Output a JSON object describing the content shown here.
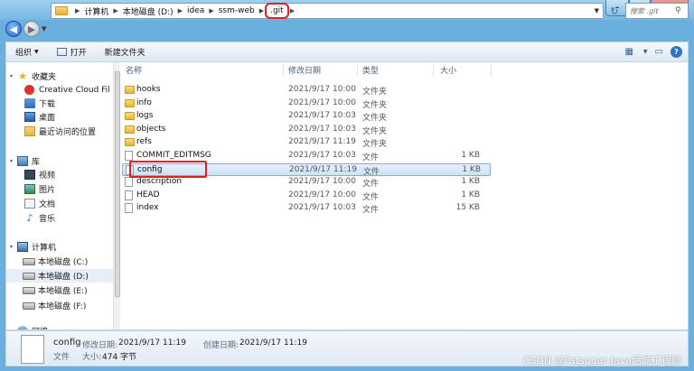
{
  "address": {
    "crumbs": [
      "计算机",
      "本地磁盘 (D:)",
      "idea",
      "ssm-web",
      ".git"
    ]
  },
  "search": {
    "placeholder": "搜索 .git"
  },
  "toolbar": {
    "organize": "组织",
    "open": "打开",
    "new_folder": "新建文件夹"
  },
  "sidebar": {
    "favorites": "收藏夹",
    "fav_items": [
      "Creative Cloud Fil",
      "下载",
      "桌面",
      "最近访问的位置"
    ],
    "libraries": "库",
    "lib_items": [
      "视频",
      "图片",
      "文档",
      "音乐"
    ],
    "computer": "计算机",
    "drives": [
      "本地磁盘 (C:)",
      "本地磁盘 (D:)",
      "本地磁盘 (E:)",
      "本地磁盘 (F:)"
    ],
    "network": "网络"
  },
  "columns": {
    "name": "名称",
    "date": "修改日期",
    "type": "类型",
    "size": "大小"
  },
  "files": [
    {
      "name": "hooks",
      "date": "2021/9/17 10:00",
      "type": "文件夹",
      "size": "",
      "kind": "folder"
    },
    {
      "name": "info",
      "date": "2021/9/17 10:00",
      "type": "文件夹",
      "size": "",
      "kind": "folder"
    },
    {
      "name": "logs",
      "date": "2021/9/17 10:03",
      "type": "文件夹",
      "size": "",
      "kind": "folder"
    },
    {
      "name": "objects",
      "date": "2021/9/17 10:03",
      "type": "文件夹",
      "size": "",
      "kind": "folder"
    },
    {
      "name": "refs",
      "date": "2021/9/17 11:19",
      "type": "文件夹",
      "size": "",
      "kind": "folder"
    },
    {
      "name": "COMMIT_EDITMSG",
      "date": "2021/9/17 10:03",
      "type": "文件",
      "size": "1 KB",
      "kind": "file"
    },
    {
      "name": "config",
      "date": "2021/9/17 11:19",
      "type": "文件",
      "size": "1 KB",
      "kind": "file"
    },
    {
      "name": "description",
      "date": "2021/9/17 10:00",
      "type": "文件",
      "size": "1 KB",
      "kind": "file"
    },
    {
      "name": "HEAD",
      "date": "2021/9/17 10:00",
      "type": "文件",
      "size": "1 KB",
      "kind": "file"
    },
    {
      "name": "index",
      "date": "2021/9/17 10:03",
      "type": "文件",
      "size": "15 KB",
      "kind": "file"
    }
  ],
  "details": {
    "name": "config",
    "modified_label": "修改日期:",
    "modified": "2021/9/17 11:19",
    "created_label": "创建日期:",
    "created": "2021/9/17 11:19",
    "type": "文件",
    "size_label": "大小:",
    "size": "474 字节"
  },
  "watermark": "CSDN @Fatsugar-Java后端工程师",
  "colors": {
    "highlight": "#e02020",
    "selection": "#cde2f7",
    "chrome": "#78b8e2"
  }
}
